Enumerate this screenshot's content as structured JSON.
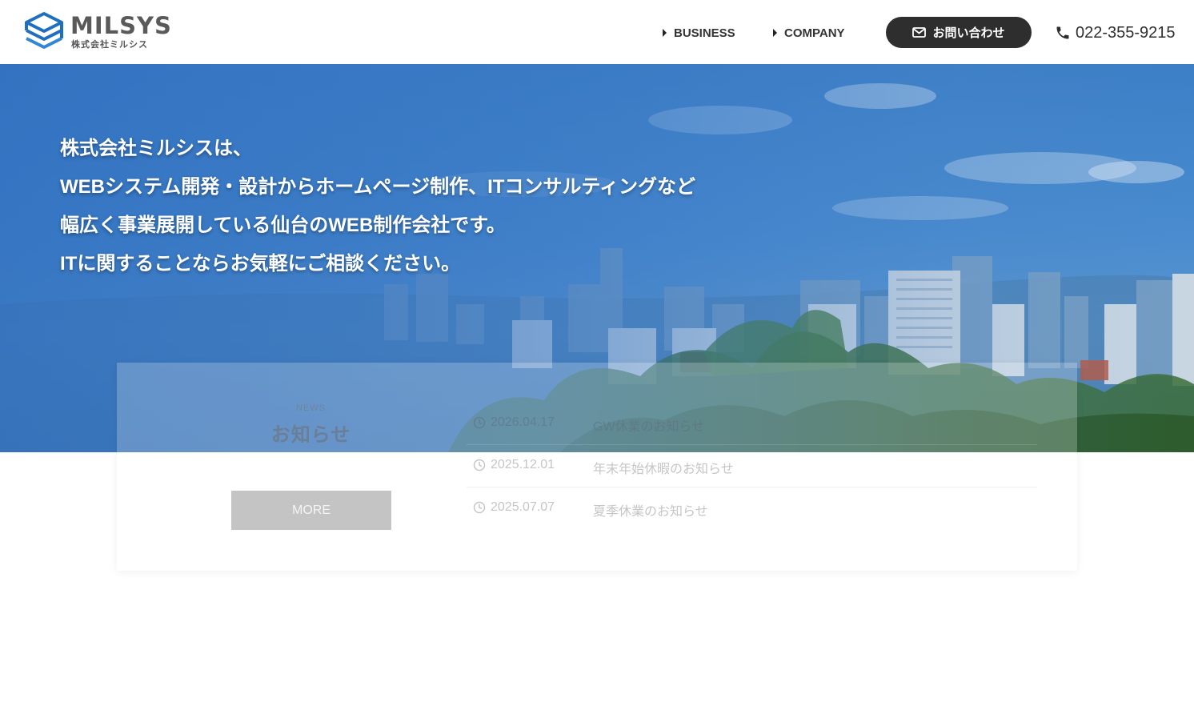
{
  "header": {
    "logo": {
      "name": "MILSYS",
      "subtitle": "株式会社ミルシス"
    },
    "nav": [
      {
        "label": "BUSINESS"
      },
      {
        "label": "COMPANY"
      }
    ],
    "contact_label": "お問い合わせ",
    "phone": "022-355-9215"
  },
  "hero": {
    "lines": [
      "株式会社ミルシスは、",
      "WEBシステム開発・設計からホームページ制作、ITコンサルティングなど",
      "幅広く事業展開している仙台のWEB制作会社です。",
      "ITに関することならお気軽にご相談ください。"
    ]
  },
  "news": {
    "label_en": "NEWS",
    "label_ja": "お知らせ",
    "more_label": "MORE",
    "items": [
      {
        "date": "2026.04.17",
        "title": "GW休業のお知らせ"
      },
      {
        "date": "2025.12.01",
        "title": "年末年始休暇のお知らせ"
      },
      {
        "date": "2025.07.07",
        "title": "夏季休業のお知らせ"
      }
    ]
  },
  "colors": {
    "brand_blue": "#1f6fc0",
    "dark": "#2e2e2e",
    "hero_blue": "#3d7fc6",
    "more_gray": "#c4c4c4"
  },
  "icons": [
    "logo-mark-icon",
    "triangle-right-icon",
    "mail-icon",
    "phone-icon",
    "clock-icon"
  ]
}
